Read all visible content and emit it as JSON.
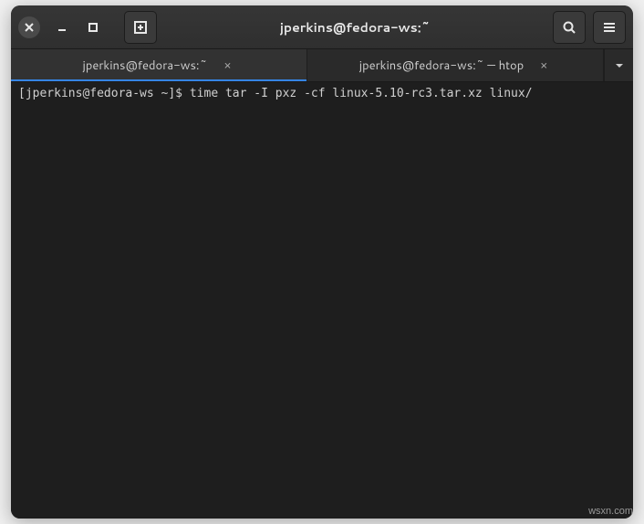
{
  "window": {
    "title": "jperkins@fedora-ws:~"
  },
  "tabs": [
    {
      "label": "jperkins@fedora-ws:~",
      "active": true
    },
    {
      "label": "jperkins@fedora-ws:~ — htop",
      "active": false
    }
  ],
  "terminal": {
    "prompt": "[jperkins@fedora-ws ~]$ ",
    "command": "time tar -I pxz -cf linux-5.10-rc3.tar.xz linux/"
  },
  "watermark": "wsxn.com"
}
